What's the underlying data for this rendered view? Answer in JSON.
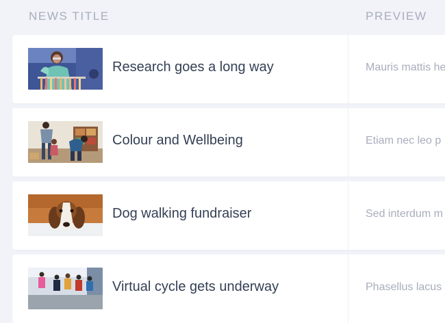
{
  "header": {
    "news_title": "NEWS TITLE",
    "preview": "PREVIEW"
  },
  "rows": [
    {
      "title": "Research goes a long way",
      "preview": "Mauris mattis he",
      "thumbnail_icon": "lab-scientist-photo"
    },
    {
      "title": "Colour and Wellbeing",
      "preview": "Etiam nec leo p",
      "thumbnail_icon": "playroom-photo"
    },
    {
      "title": "Dog walking fundraiser",
      "preview": "Sed interdum m",
      "thumbnail_icon": "beagle-photo"
    },
    {
      "title": "Virtual cycle gets underway",
      "preview": "Phasellus lacus",
      "thumbnail_icon": "cyclists-photo"
    }
  ]
}
